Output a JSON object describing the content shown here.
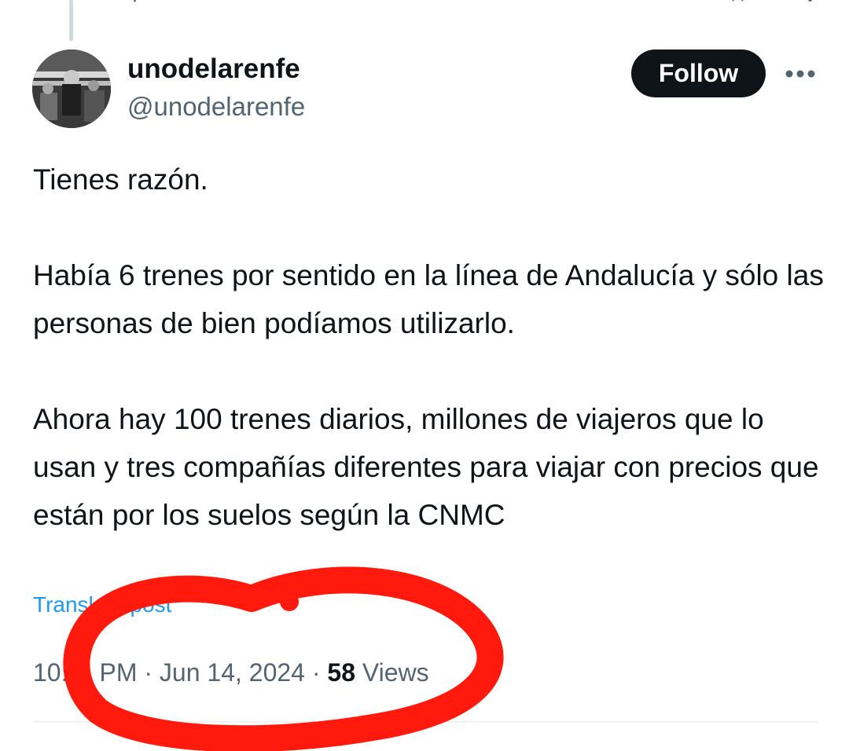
{
  "thread": {
    "connector": true
  },
  "author": {
    "display_name": "unodelarenfe",
    "handle": "@unodelarenfe",
    "avatar_icon": "profile-photo"
  },
  "actions": {
    "follow_label": "Follow",
    "more_icon": "more-dots-icon"
  },
  "tweet": {
    "paragraphs": [
      "Tienes razón.",
      "Había 6 trenes por sentido en la línea de Andalucía y sólo las personas de bien podíamos utilizarlo.",
      "Ahora hay 100 trenes diarios, millones de viajeros que lo usan y tres compañías diferentes para viajar con precios que están por los suelos según la CNMC"
    ],
    "translate_label": "Translate post"
  },
  "meta": {
    "time": "10:",
    "time_suffix": "PM",
    "date": "Jun 14, 2024",
    "separator": "·",
    "views_count": "58",
    "views_label": "Views"
  },
  "colors": {
    "text": "#0f1419",
    "muted": "#536471",
    "link": "#1d9bf0",
    "annotation": "#ff1a0d"
  }
}
